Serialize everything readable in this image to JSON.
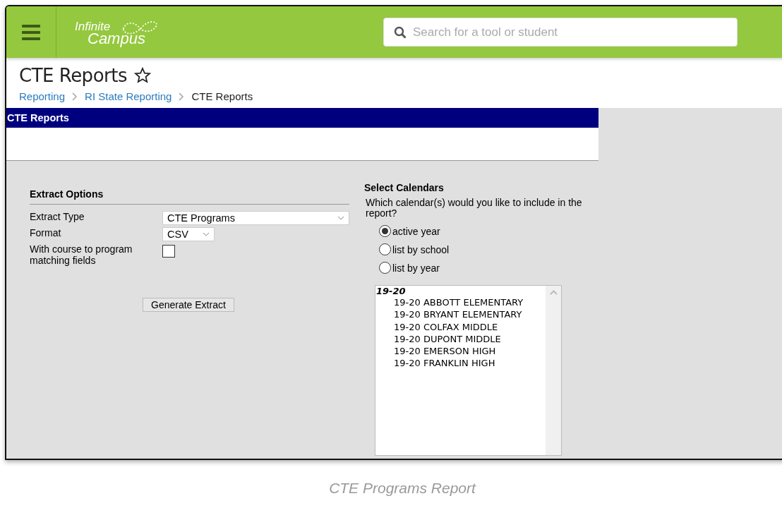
{
  "header": {
    "logo_line_1": "Infinite",
    "logo_line_2": "Campus",
    "search": {
      "placeholder": "Search for a tool or student"
    }
  },
  "page": {
    "title": "CTE Reports",
    "favorite": false,
    "breadcrumbs": [
      {
        "label": "Reporting",
        "link": true
      },
      {
        "label": "RI State Reporting",
        "link": true
      },
      {
        "label": "CTE Reports",
        "link": false
      }
    ]
  },
  "panel": {
    "title": "CTE Reports"
  },
  "extract_options": {
    "heading": "Extract Options",
    "fields": [
      {
        "kind": "select",
        "label": "Extract Type",
        "value": "CTE Programs"
      },
      {
        "kind": "select",
        "label": "Format",
        "value": "CSV"
      },
      {
        "kind": "checkbox",
        "label": "With course to program matching fields",
        "checked": false
      }
    ],
    "button": "Generate Extract"
  },
  "select_calendars": {
    "heading": "Select Calendars",
    "question": "Which calendar(s) would you like to include in the report?",
    "options": [
      {
        "label": "active year",
        "selected": true
      },
      {
        "label": "list by school",
        "selected": false
      },
      {
        "label": "list by year",
        "selected": false
      }
    ],
    "list": {
      "group": "19-20",
      "items": [
        "19-20 ABBOTT ELEMENTARY",
        "19-20 BRYANT ELEMENTARY",
        "19-20 COLFAX MIDDLE",
        "19-20 DUPONT MIDDLE",
        "19-20 EMERSON HIGH",
        "19-20 FRANKLIN HIGH"
      ]
    }
  },
  "caption": "CTE Programs Report"
}
